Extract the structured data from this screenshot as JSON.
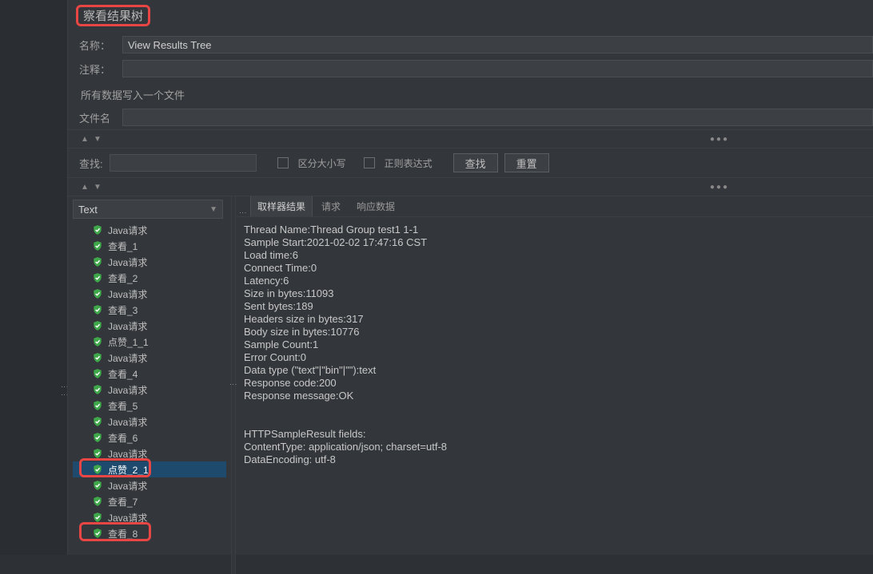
{
  "title": "察看结果树",
  "form": {
    "name_label": "名称：",
    "name_value": "View Results Tree",
    "comment_label": "注释：",
    "comment_value": "",
    "write_all_label": "所有数据写入一个文件",
    "filename_label": "文件名",
    "filename_value": ""
  },
  "search": {
    "label": "查找:",
    "value": "",
    "case_label": "区分大小写",
    "regex_label": "正则表达式",
    "find_btn": "查找",
    "reset_btn": "重置"
  },
  "dropdown": {
    "value": "Text"
  },
  "tree_items": [
    {
      "label": "Java请求",
      "selected": false
    },
    {
      "label": "查看_1",
      "selected": false
    },
    {
      "label": "Java请求",
      "selected": false
    },
    {
      "label": "查看_2",
      "selected": false
    },
    {
      "label": "Java请求",
      "selected": false
    },
    {
      "label": "查看_3",
      "selected": false
    },
    {
      "label": "Java请求",
      "selected": false
    },
    {
      "label": "点赞_1_1",
      "selected": false
    },
    {
      "label": "Java请求",
      "selected": false
    },
    {
      "label": "查看_4",
      "selected": false
    },
    {
      "label": "Java请求",
      "selected": false
    },
    {
      "label": "查看_5",
      "selected": false
    },
    {
      "label": "Java请求",
      "selected": false
    },
    {
      "label": "查看_6",
      "selected": false
    },
    {
      "label": "Java请求",
      "selected": false
    },
    {
      "label": "点赞_2_1",
      "selected": true
    },
    {
      "label": "Java请求",
      "selected": false
    },
    {
      "label": "查看_7",
      "selected": false
    },
    {
      "label": "Java请求",
      "selected": false
    },
    {
      "label": "查看_8",
      "selected": false
    }
  ],
  "tabs": {
    "sampler": "取样器结果",
    "request": "请求",
    "response": "响应数据"
  },
  "detail_lines": [
    "Thread Name:Thread Group test1 1-1",
    "Sample Start:2021-02-02 17:47:16 CST",
    "Load time:6",
    "Connect Time:0",
    "Latency:6",
    "Size in bytes:11093",
    "Sent bytes:189",
    "Headers size in bytes:317",
    "Body size in bytes:10776",
    "Sample Count:1",
    "Error Count:0",
    "Data type (\"text\"|\"bin\"|\"\"):text",
    "Response code:200",
    "Response message:OK",
    "",
    "",
    "HTTPSampleResult fields:",
    "ContentType: application/json; charset=utf-8",
    "DataEncoding: utf-8"
  ]
}
